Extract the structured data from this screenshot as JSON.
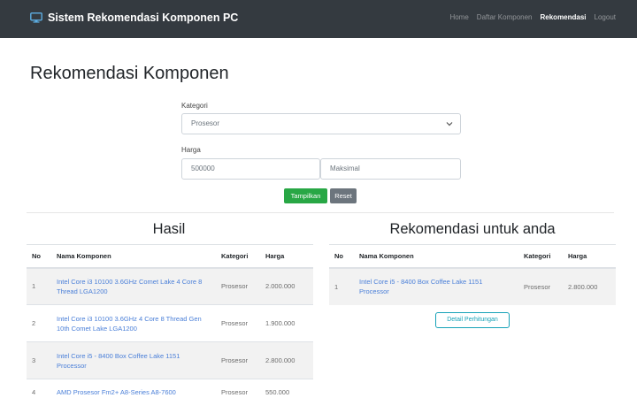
{
  "navbar": {
    "brand": "Sistem Rekomendasi Komponen PC",
    "links": [
      {
        "label": "Home"
      },
      {
        "label": "Daftar Komponen"
      },
      {
        "label": "Rekomendasi"
      },
      {
        "label": "Logout"
      }
    ],
    "active": "Rekomendasi"
  },
  "page_title": "Rekomendasi Komponen",
  "form": {
    "kategori_label": "Kategori",
    "kategori_value": "Prosesor",
    "harga_label": "Harga",
    "harga_min_value": "500000",
    "harga_max_placeholder": "Maksimal",
    "tampilkan_label": "Tampilkan",
    "reset_label": "Reset"
  },
  "hasil": {
    "title": "Hasil",
    "headers": [
      "No",
      "Nama Komponen",
      "Kategori",
      "Harga"
    ],
    "rows": [
      {
        "no": "1",
        "nama": "Intel Core i3 10100 3.6GHz Comet Lake 4 Core 8 Thread LGA1200",
        "kategori": "Prosesor",
        "harga": "2.000.000"
      },
      {
        "no": "2",
        "nama": "Intel Core i3 10100 3.6GHz 4 Core 8 Thread Gen 10th Comet Lake LGA1200",
        "kategori": "Prosesor",
        "harga": "1.900.000"
      },
      {
        "no": "3",
        "nama": "Intel Core i5 - 8400 Box Coffee Lake 1151 Processor",
        "kategori": "Prosesor",
        "harga": "2.800.000"
      },
      {
        "no": "4",
        "nama": "AMD Prosesor Fm2+ A8-Series A8-7600",
        "kategori": "Prosesor",
        "harga": "550.000"
      }
    ]
  },
  "rekomendasi": {
    "title": "Rekomendasi untuk anda",
    "headers": [
      "No",
      "Nama Komponen",
      "Kategori",
      "Harga"
    ],
    "rows": [
      {
        "no": "1",
        "nama": "Intel Core i5 - 8400 Box Coffee Lake 1151 Processor",
        "kategori": "Prosesor",
        "harga": "2.800.000"
      }
    ],
    "detail_label": "Detail Perhitungan"
  },
  "colors": {
    "navbar": "#343a40",
    "success": "#28a745",
    "secondary": "#6c757d",
    "info": "#17a2b8",
    "link": "#4a7fd8"
  },
  "icons": {
    "brand": "monitor-icon",
    "select": "chevron-down-icon"
  }
}
